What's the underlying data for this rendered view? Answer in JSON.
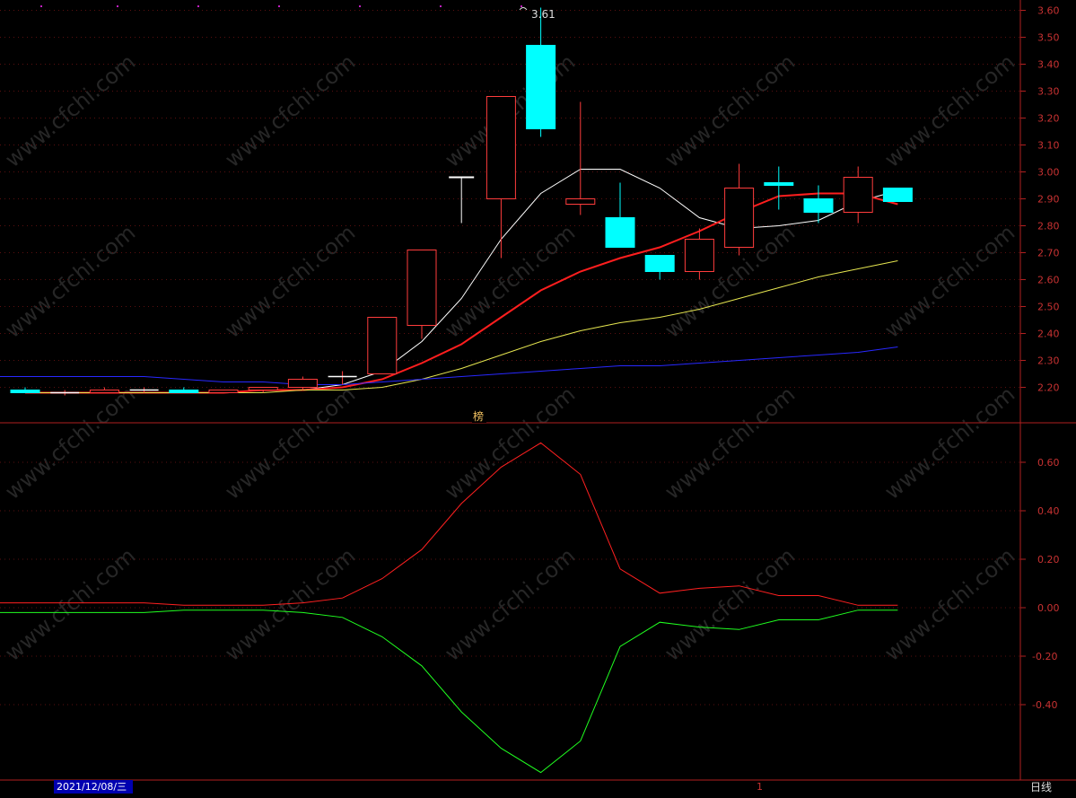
{
  "chart_data": [
    {
      "type": "candlestick",
      "panel": "price",
      "ylim": [
        2.13,
        3.63
      ],
      "yticks": [
        "3.60",
        "3.50",
        "3.40",
        "3.30",
        "3.20",
        "3.10",
        "3.00",
        "2.90",
        "2.80",
        "2.70",
        "2.60",
        "2.50",
        "2.40",
        "2.30",
        "2.20"
      ],
      "high_annotation": "3.61",
      "marker_label": "榜",
      "up_color": "#ff3c3c",
      "down_color": "#00ffff",
      "candles": [
        {
          "o": 2.19,
          "h": 2.2,
          "l": 2.18,
          "c": 2.18
        },
        {
          "o": 2.18,
          "h": 2.19,
          "l": 2.17,
          "c": 2.18
        },
        {
          "o": 2.18,
          "h": 2.2,
          "l": 2.18,
          "c": 2.19
        },
        {
          "o": 2.19,
          "h": 2.2,
          "l": 2.18,
          "c": 2.19
        },
        {
          "o": 2.19,
          "h": 2.2,
          "l": 2.18,
          "c": 2.18
        },
        {
          "o": 2.18,
          "h": 2.19,
          "l": 2.18,
          "c": 2.19
        },
        {
          "o": 2.19,
          "h": 2.2,
          "l": 2.18,
          "c": 2.2
        },
        {
          "o": 2.2,
          "h": 2.24,
          "l": 2.19,
          "c": 2.23
        },
        {
          "o": 2.24,
          "h": 2.26,
          "l": 2.21,
          "c": 2.24
        },
        {
          "o": 2.25,
          "h": 2.46,
          "l": 2.25,
          "c": 2.46
        },
        {
          "o": 2.43,
          "h": 2.71,
          "l": 2.38,
          "c": 2.71
        },
        {
          "o": 2.98,
          "h": 2.98,
          "l": 2.81,
          "c": 2.98
        },
        {
          "o": 2.9,
          "h": 3.28,
          "l": 2.68,
          "c": 3.28
        },
        {
          "o": 3.47,
          "h": 3.61,
          "l": 3.13,
          "c": 3.16
        },
        {
          "o": 2.88,
          "h": 3.26,
          "l": 2.84,
          "c": 2.9
        },
        {
          "o": 2.83,
          "h": 2.96,
          "l": 2.72,
          "c": 2.72
        },
        {
          "o": 2.69,
          "h": 2.69,
          "l": 2.6,
          "c": 2.63
        },
        {
          "o": 2.63,
          "h": 2.79,
          "l": 2.6,
          "c": 2.75
        },
        {
          "o": 2.72,
          "h": 3.03,
          "l": 2.69,
          "c": 2.94
        },
        {
          "o": 2.96,
          "h": 3.02,
          "l": 2.86,
          "c": 2.95
        },
        {
          "o": 2.9,
          "h": 2.95,
          "l": 2.81,
          "c": 2.85
        },
        {
          "o": 2.85,
          "h": 3.02,
          "l": 2.81,
          "c": 2.98
        },
        {
          "o": 2.94,
          "h": 2.94,
          "l": 2.89,
          "c": 2.89
        }
      ],
      "series": [
        {
          "color": "#ffffff",
          "width": 1,
          "values": [
            2.18,
            2.18,
            2.18,
            2.18,
            2.18,
            2.18,
            2.19,
            2.19,
            2.21,
            2.26,
            2.37,
            2.53,
            2.75,
            2.92,
            3.01,
            3.01,
            2.94,
            2.83,
            2.79,
            2.8,
            2.82,
            2.89,
            2.93
          ]
        },
        {
          "color": "#ff1e1e",
          "width": 2,
          "values": [
            2.18,
            2.18,
            2.18,
            2.18,
            2.18,
            2.18,
            2.19,
            2.19,
            2.2,
            2.23,
            2.29,
            2.36,
            2.46,
            2.56,
            2.63,
            2.68,
            2.72,
            2.78,
            2.85,
            2.91,
            2.92,
            2.92,
            2.88
          ]
        },
        {
          "color": "#e6e650",
          "width": 1,
          "values": [
            2.18,
            2.18,
            2.18,
            2.18,
            2.18,
            2.18,
            2.18,
            2.19,
            2.19,
            2.2,
            2.23,
            2.27,
            2.32,
            2.37,
            2.41,
            2.44,
            2.46,
            2.49,
            2.53,
            2.57,
            2.61,
            2.64,
            2.67
          ]
        },
        {
          "color": "#2828ff",
          "width": 1,
          "values": [
            2.24,
            2.24,
            2.24,
            2.24,
            2.23,
            2.22,
            2.22,
            2.21,
            2.21,
            2.22,
            2.23,
            2.24,
            2.25,
            2.26,
            2.27,
            2.28,
            2.28,
            2.29,
            2.3,
            2.31,
            2.32,
            2.33,
            2.35
          ]
        }
      ]
    },
    {
      "type": "line",
      "panel": "indicator",
      "ylim": [
        -0.68,
        0.74
      ],
      "yticks": [
        "0.60",
        "0.40",
        "0.20",
        "0.00",
        "-0.20",
        "-0.40"
      ],
      "series": [
        {
          "color": "#ff2020",
          "values": [
            0.02,
            0.02,
            0.02,
            0.02,
            0.01,
            0.01,
            0.01,
            0.02,
            0.04,
            0.12,
            0.24,
            0.43,
            0.58,
            0.68,
            0.55,
            0.16,
            0.06,
            0.08,
            0.09,
            0.05,
            0.05,
            0.01,
            0.01
          ]
        },
        {
          "color": "#20ff20",
          "values": [
            -0.02,
            -0.02,
            -0.02,
            -0.02,
            -0.01,
            -0.01,
            -0.01,
            -0.02,
            -0.04,
            -0.12,
            -0.24,
            -0.43,
            -0.58,
            -0.68,
            -0.55,
            -0.16,
            -0.06,
            -0.08,
            -0.09,
            -0.05,
            -0.05,
            -0.01,
            -0.01
          ]
        }
      ]
    }
  ],
  "footer": {
    "date_label": "2021/12/08/三",
    "cursor_label": "1",
    "period_label": "日线"
  },
  "watermark": "www.cfchi.com"
}
